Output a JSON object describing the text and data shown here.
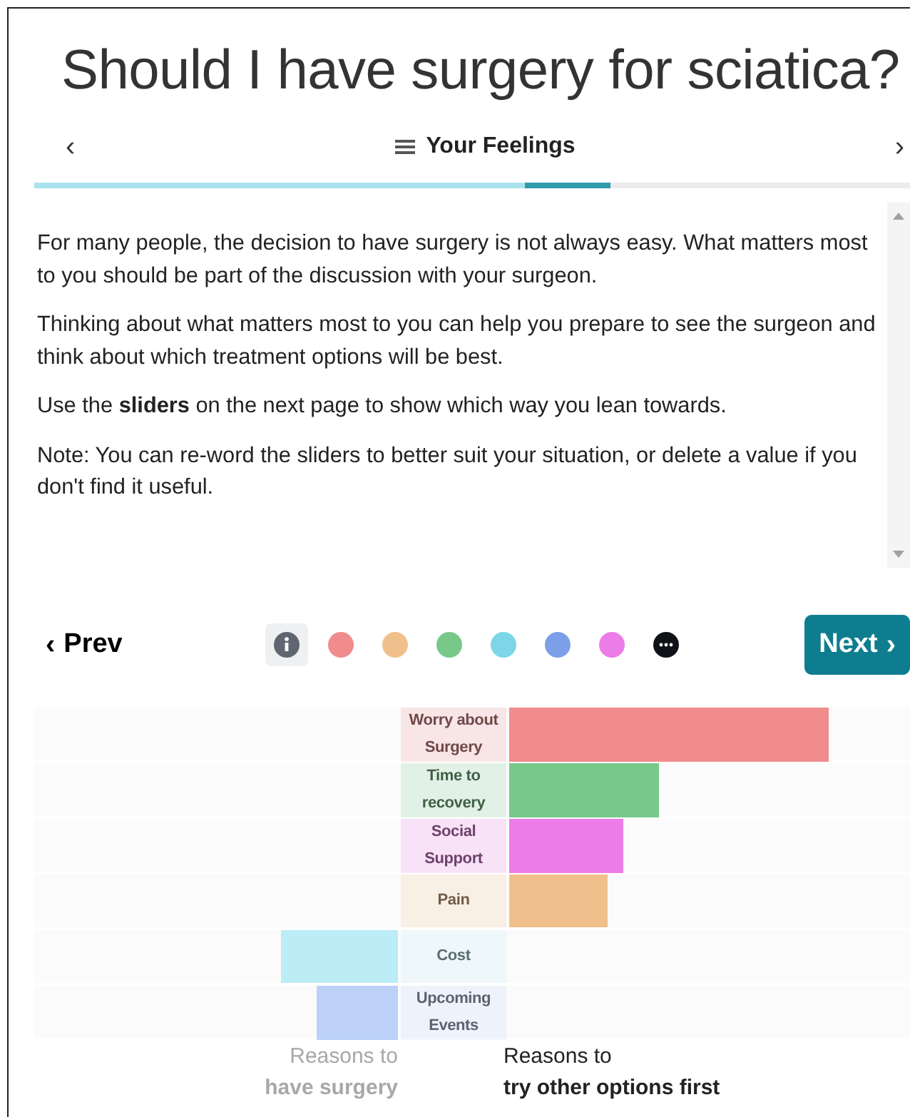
{
  "title": "Should I have surgery for sciatica?",
  "nav": {
    "prev": "‹",
    "section": "Your Feelings",
    "next": "›"
  },
  "progress": [
    {
      "kind": "done"
    },
    {
      "kind": "current"
    },
    {
      "kind": "todo"
    }
  ],
  "paragraphs": [
    "For many people, the decision to have surgery is not always easy. What matters most to you should be part of the discussion with your surgeon.",
    "Thinking about what matters most to you can help you prepare to see the surgeon and think about which treatment options will be best.",
    "Use the **sliders** on the next page to show which way you lean towards.",
    "Note: You can re-word the sliders to better suit your situation, or delete a value if you don't find it useful."
  ],
  "pager": {
    "prev_icon": "‹",
    "prev": "Prev",
    "next": "Next",
    "next_icon": "›",
    "dots": [
      {
        "kind": "info",
        "selected": true
      },
      {
        "kind": "color",
        "color": "#f08c8c",
        "selected": false
      },
      {
        "kind": "color",
        "color": "#f0c08c",
        "selected": false
      },
      {
        "kind": "color",
        "color": "#78c88a",
        "selected": false
      },
      {
        "kind": "color",
        "color": "#7cd6e8",
        "selected": false
      },
      {
        "kind": "color",
        "color": "#7ca0e8",
        "selected": false
      },
      {
        "kind": "color",
        "color": "#ec7ce8",
        "selected": false
      },
      {
        "kind": "more",
        "selected": false
      }
    ]
  },
  "factors": [
    {
      "label": "Worry about Surgery",
      "color": "#f08c8c",
      "kind": "right"
    },
    {
      "label": "Time to recovery",
      "color": "#78c88a",
      "kind": "right"
    },
    {
      "label": "Social Support",
      "color": "#ec7ce8",
      "kind": "right"
    },
    {
      "label": "Pain",
      "color": "#f0c08c",
      "kind": "right"
    },
    {
      "label": "Cost",
      "color": "#bcecf6",
      "kind": "left"
    },
    {
      "label": "Upcoming Events",
      "color": "#bcd0f8",
      "kind": "left"
    }
  ],
  "left_caption": {
    "line1": "Reasons to",
    "line2": "have surgery"
  },
  "right_caption": {
    "line1": "Reasons to",
    "line2": "try other options first"
  }
}
